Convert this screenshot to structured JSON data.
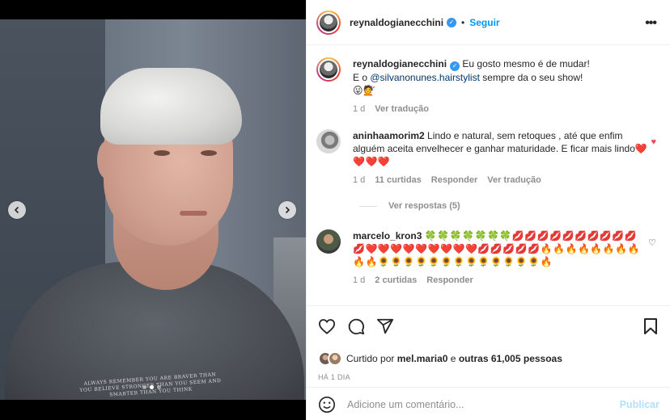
{
  "post": {
    "media": {
      "shirt_text": "ALWAYS REMEMBER YOU ARE BRAVER THAN YOU BELIEVE STRONGER THAN YOU SEEM AND SMARTER THAN YOU THINK",
      "carousel": {
        "count": 3,
        "active_index": 1
      },
      "prev_icon": "chevron-left-icon",
      "next_icon": "chevron-right-icon"
    },
    "header": {
      "username": "reynaldogianecchini",
      "separator": "•",
      "follow_label": "Seguir",
      "more_icon": "more-options-icon"
    },
    "caption": {
      "username": "reynaldogianecchini",
      "text_1": "Eu gosto mesmo é de mudar!",
      "text_2_prefix": "E o ",
      "mention": "@silvanonunes.hairstylist",
      "text_2_suffix": " sempre da o seu show!",
      "emojis": "😛💇",
      "time": "1 d",
      "translate_label": "Ver tradução"
    },
    "comments": [
      {
        "username": "aninhaamorim2",
        "text": "Lindo e natural, sem retoques , até que enfim alguém aceita envelhecer e ganhar maturidade. E ficar mais lindo",
        "emojis": "❤️❤️❤️❤️",
        "time": "1 d",
        "likes": "11 curtidas",
        "reply_label": "Responder",
        "translate_label": "Ver tradução",
        "liked": true,
        "view_replies": "Ver respostas (5)"
      },
      {
        "username": "marcelo_kron3",
        "text": "🍀🍀🍀🍀🍀🍀🍀💋💋💋💋💋💋💋💋💋💋💋❤️❤️❤️❤️❤️❤️❤️❤️❤️💋💋💋💋💋🔥🔥🔥🔥🔥🔥🔥🔥🔥🔥🌻🌻🌻🌻🌻🌻🌻🌻🌻🌻🌻🌻🌻🔥",
        "time": "1 d",
        "likes": "2 curtidas",
        "reply_label": "Responder",
        "liked": false
      }
    ],
    "actions": {
      "like_icon": "heart-icon",
      "comment_icon": "comment-icon",
      "share_icon": "share-icon",
      "save_icon": "bookmark-icon"
    },
    "likes": {
      "prefix": "Curtido por",
      "user": "mel.maria0",
      "middle": "e",
      "others": "outras 61,005 pessoas"
    },
    "timestamp": "HÁ 1 DIA",
    "add_comment": {
      "emoji_icon": "emoji-icon",
      "placeholder": "Adicione um comentário...",
      "publish_label": "Publicar"
    }
  },
  "colors": {
    "link": "#0095f6",
    "mention": "#00376b",
    "verified": "#3897f0",
    "like_red": "#ed4956",
    "muted": "#8e8e8e",
    "publish_disabled": "#b2dffc"
  }
}
